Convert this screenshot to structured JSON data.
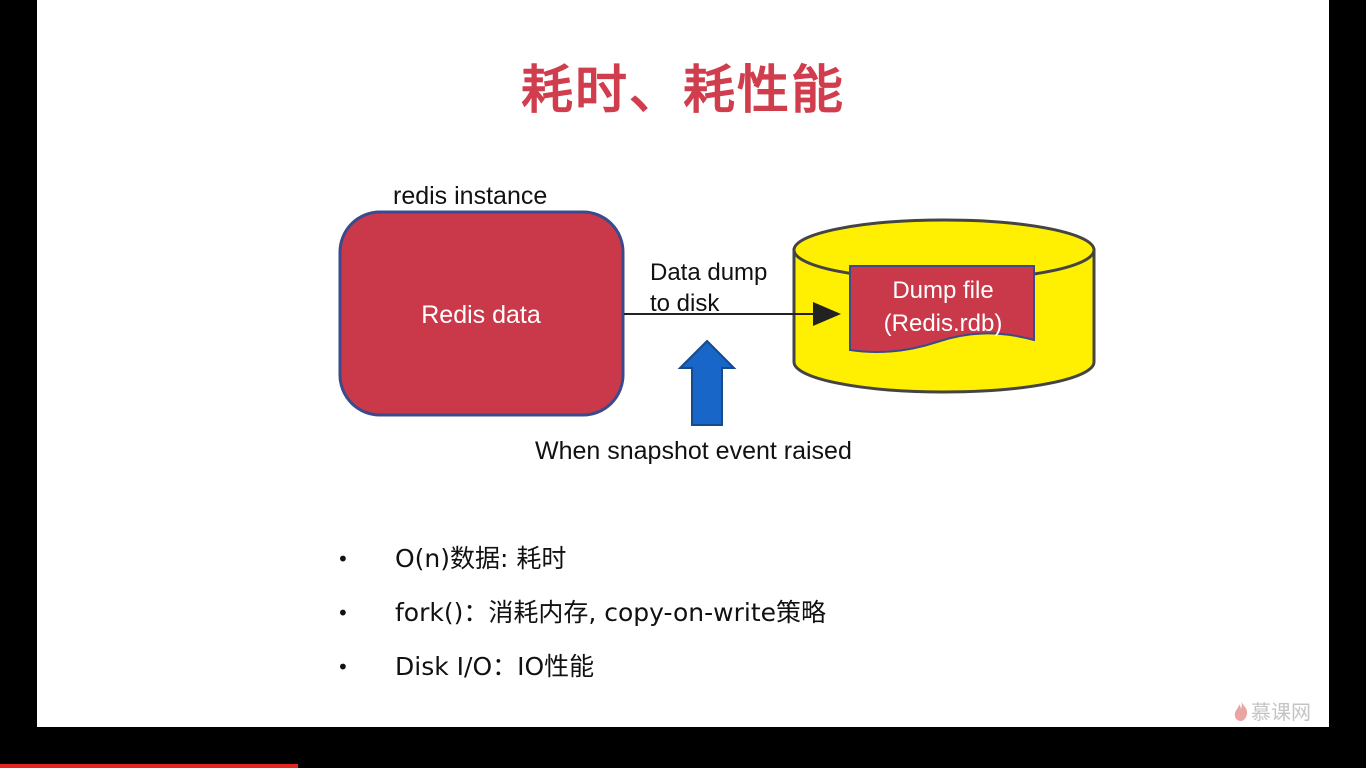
{
  "slide": {
    "title": "耗时、耗性能",
    "diagram": {
      "instance_label": "redis instance",
      "box_text": "Redis data",
      "arrow_label_line1": "Data dump",
      "arrow_label_line2": "to disk",
      "file_line1": "Dump file",
      "file_line2": "(Redis.rdb)",
      "event_label": "When snapshot event raised",
      "colors": {
        "box": "#c9394a",
        "box_border": "#3b4a8c",
        "cylinder": "#ffef00",
        "arrow_up": "#1866c8"
      }
    },
    "bullets": [
      {
        "marker": "•",
        "text": "O(n)数据: 耗时"
      },
      {
        "marker": "•",
        "text": "fork()：消耗内存, copy-on-write策略"
      },
      {
        "marker": "•",
        "text": "Disk I/O：IO性能"
      }
    ]
  },
  "logo": {
    "text": "慕课网",
    "icon": "flame-icon"
  }
}
